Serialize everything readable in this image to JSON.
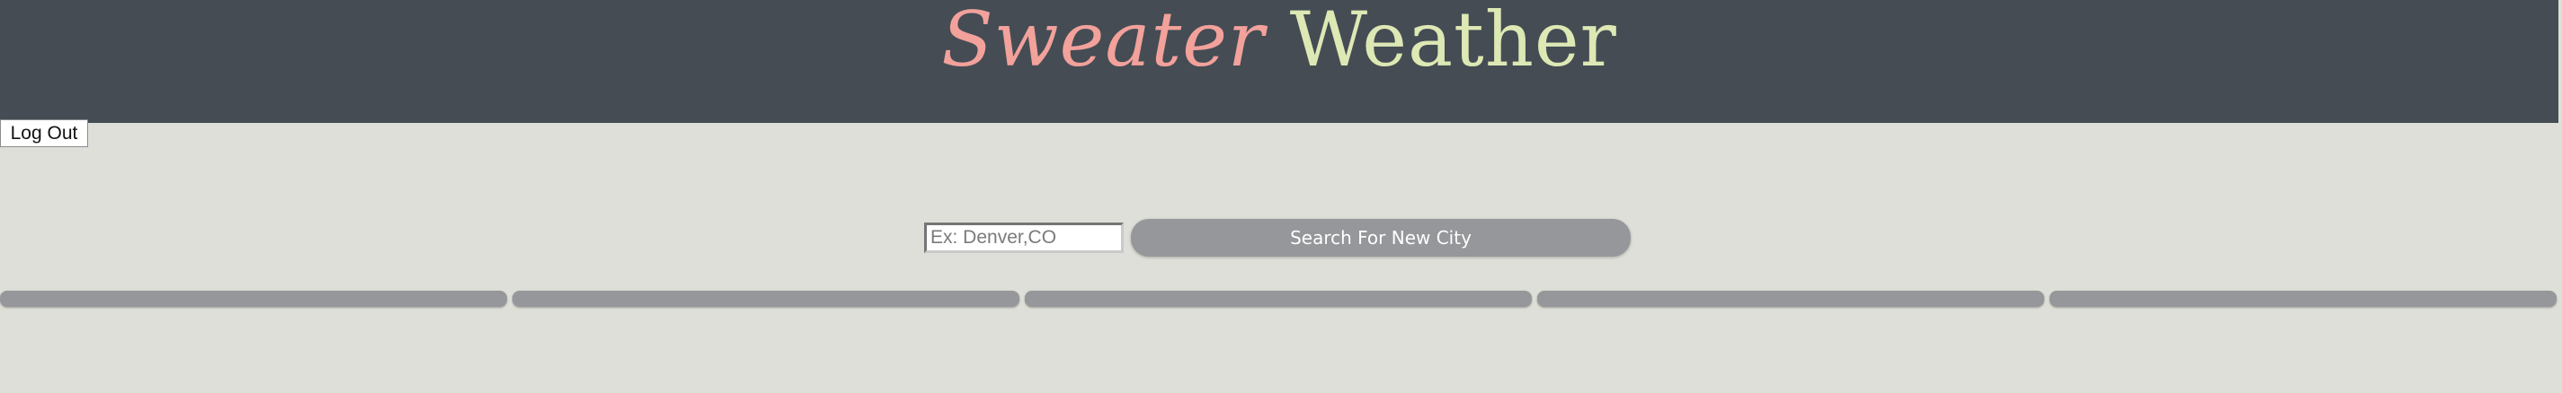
{
  "header": {
    "title_part1": "Sweater",
    "title_part2": "Weather"
  },
  "auth": {
    "logout_label": "Log Out"
  },
  "search": {
    "placeholder": "Ex: Denver,CO",
    "value": "",
    "button_label": "Search For New City"
  },
  "forecast": {
    "card_count": 5
  },
  "colors": {
    "header_bg": "#454c54",
    "page_bg": "#dddfd8",
    "title_sweater": "#f2a19b",
    "title_weather": "#dde8b4",
    "button_bg": "#96979a"
  }
}
